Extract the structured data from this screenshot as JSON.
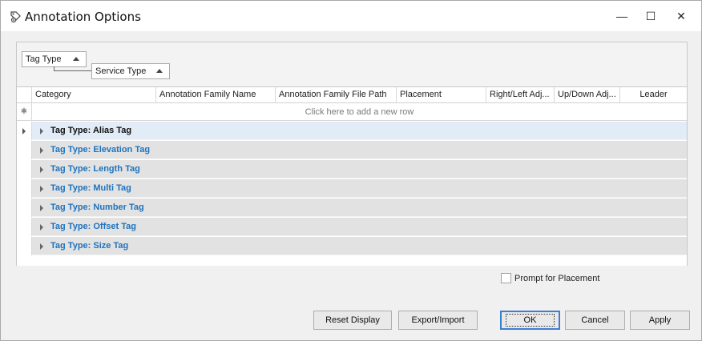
{
  "window": {
    "title": "Annotation Options",
    "controls": {
      "minimize": "—",
      "maximize": "☐",
      "close": "✕"
    }
  },
  "group_panel": {
    "groups": [
      "Tag Type",
      "Service Type"
    ]
  },
  "grid": {
    "columns": [
      "Category",
      "Annotation Family Name",
      "Annotation Family File Path",
      "Placement",
      "Right/Left Adj...",
      "Up/Down Adj...",
      "Leader"
    ],
    "new_row_indicator": "✱",
    "new_row_text": "Click here to add a new row",
    "group_rows": [
      "Tag Type: Alias Tag",
      "Tag Type: Elevation Tag",
      "Tag Type: Length Tag",
      "Tag Type: Multi Tag",
      "Tag Type: Number Tag",
      "Tag Type: Offset Tag",
      "Tag Type: Size Tag"
    ],
    "selected_row": "Tag Type: Alias Tag"
  },
  "options": {
    "prompt_for_placement_label": "Prompt for Placement",
    "prompt_for_placement_checked": false
  },
  "buttons": {
    "reset_display": "Reset Display",
    "export_import": "Export/Import",
    "ok": "OK",
    "cancel": "Cancel",
    "apply": "Apply"
  },
  "colors": {
    "group_label": "#1e73be",
    "selected_row_bg": "#e1ecf7",
    "group_row_bg": "#e2e2e2",
    "primary_border": "#3c7fd1"
  }
}
